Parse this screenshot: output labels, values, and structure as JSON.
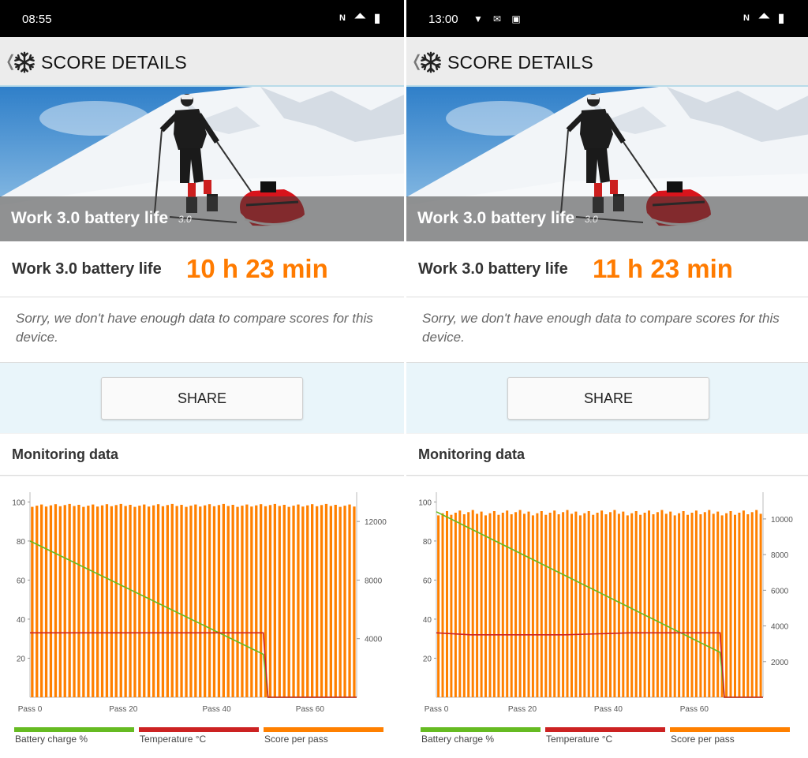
{
  "screens": [
    {
      "status_bar": {
        "time": "08:55",
        "left_icons": [],
        "right_icons": [
          "nfc-icon",
          "wifi-icon",
          "battery-icon"
        ]
      },
      "header": {
        "title": "SCORE DETAILS",
        "back_icon": "chevron-left-icon",
        "logo_icon": "snowflake-icon"
      },
      "hero": {
        "title": "Work 3.0 battery life",
        "version": "3.0"
      },
      "score": {
        "label": "Work 3.0 battery life",
        "value": "10 h 23 min"
      },
      "note": "Sorry, we don't have enough data to compare scores for this device.",
      "share_label": "SHARE",
      "monitoring_title": "Monitoring data",
      "chart_data": {
        "type": "bar",
        "x_tick_labels": [
          "Pass 0",
          "Pass 20",
          "Pass 40",
          "Pass 60"
        ],
        "x_ticks": [
          0,
          20,
          40,
          60
        ],
        "xlim": [
          0,
          70
        ],
        "left_axis": {
          "ticks": [
            20,
            40,
            60,
            80,
            100
          ],
          "ylim": [
            0,
            105
          ]
        },
        "right_axis": {
          "ticks": [
            4000,
            8000,
            12000
          ],
          "ylim": [
            0,
            14000
          ]
        },
        "series": [
          {
            "name": "Battery charge %",
            "axis": "left",
            "color": "#66bb22",
            "line": [
              [
                0,
                80
              ],
              [
                50,
                22
              ],
              [
                51,
                0
              ],
              [
                70,
                0
              ]
            ]
          },
          {
            "name": "Temperature °C",
            "axis": "left",
            "color": "#cc2222",
            "line": [
              [
                0,
                33
              ],
              [
                50,
                33
              ],
              [
                51,
                0
              ],
              [
                70,
                0
              ]
            ]
          },
          {
            "name": "Score per pass",
            "axis": "right",
            "color": "#ff8000",
            "bar_count": 70,
            "value_min": 13000,
            "value_max": 13200
          }
        ]
      }
    },
    {
      "status_bar": {
        "time": "13:00",
        "left_icons": [
          "shield-icon",
          "mail-icon",
          "gb-icon"
        ],
        "right_icons": [
          "nfc-icon",
          "wifi-icon",
          "battery-icon"
        ]
      },
      "header": {
        "title": "SCORE DETAILS",
        "back_icon": "chevron-left-icon",
        "logo_icon": "snowflake-icon"
      },
      "hero": {
        "title": "Work 3.0 battery life",
        "version": "3.0"
      },
      "score": {
        "label": "Work 3.0 battery life",
        "value": "11 h 23 min"
      },
      "note": "Sorry, we don't have enough data to compare scores for this device.",
      "share_label": "SHARE",
      "monitoring_title": "Monitoring data",
      "chart_data": {
        "type": "bar",
        "x_tick_labels": [
          "Pass 0",
          "Pass 20",
          "Pass 40",
          "Pass 60"
        ],
        "x_ticks": [
          0,
          20,
          40,
          60
        ],
        "xlim": [
          0,
          76
        ],
        "left_axis": {
          "ticks": [
            20,
            40,
            60,
            80,
            100
          ],
          "ylim": [
            0,
            105
          ]
        },
        "right_axis": {
          "ticks": [
            2000,
            4000,
            6000,
            8000,
            10000
          ],
          "ylim": [
            0,
            11500
          ]
        },
        "series": [
          {
            "name": "Battery charge %",
            "axis": "left",
            "color": "#66bb22",
            "line": [
              [
                0,
                95
              ],
              [
                66,
                23
              ],
              [
                67,
                0
              ],
              [
                76,
                0
              ]
            ]
          },
          {
            "name": "Temperature °C",
            "axis": "left",
            "color": "#cc2222",
            "line": [
              [
                0,
                33
              ],
              [
                8,
                32
              ],
              [
                30,
                32
              ],
              [
                45,
                33
              ],
              [
                66,
                33
              ],
              [
                67,
                0
              ],
              [
                76,
                0
              ]
            ]
          },
          {
            "name": "Score per pass",
            "axis": "right",
            "color": "#ff8000",
            "bar_count": 76,
            "value_min": 10200,
            "value_max": 10500
          }
        ]
      }
    }
  ]
}
